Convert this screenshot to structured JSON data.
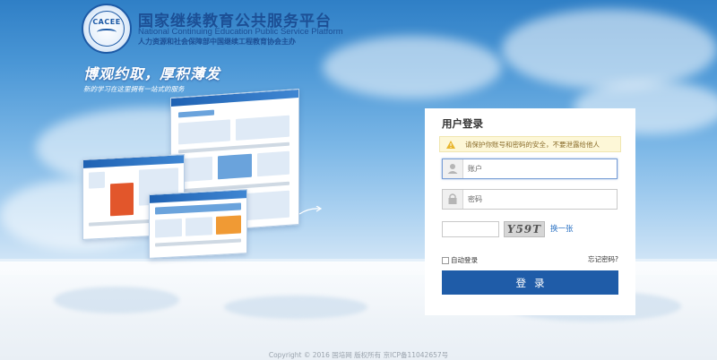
{
  "header": {
    "logo_text": "CACEE",
    "title": "国家继续教育公共服务平台",
    "subtitle": "National Continuing Education Public Service Platform",
    "organizer": "人力资源和社会保障部中国继续工程教育协会主办"
  },
  "banner": {
    "slogan": "博观约取，厚积薄发",
    "tagline": "新的学习在这里拥有一站式的服务"
  },
  "login": {
    "title": "用户登录",
    "notice_icon": "warning-icon",
    "notice": "请保护你账号和密码的安全，不要泄露给他人",
    "username_placeholder": "账户",
    "username_icon": "user-icon",
    "password_placeholder": "密码",
    "password_icon": "lock-icon",
    "captcha_text": "Y59T",
    "captcha_refresh": "换一张",
    "remember_label": "自动登录",
    "forgot_label": "忘记密码?",
    "submit_label": "登录"
  },
  "footer": {
    "copyright": "Copyright © 2016 国培网   版权所有   京ICP备11042657号"
  },
  "colors": {
    "brand_blue": "#1f5ca8",
    "link_blue": "#2b72c4",
    "title_blue": "#1c4f95",
    "notice_bg": "#fdf7d7"
  }
}
